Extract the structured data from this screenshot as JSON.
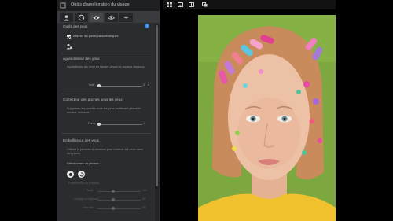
{
  "window": {
    "title": "Outils d'amélioration du visage"
  },
  "tabs": [
    {
      "icon": "portrait-icon",
      "active": false
    },
    {
      "icon": "face-icon",
      "active": false
    },
    {
      "icon": "eye-icon",
      "active": true
    },
    {
      "icon": "eye-outline-icon",
      "active": false
    },
    {
      "icon": "mouth-icon",
      "active": false
    }
  ],
  "eyes_tools": {
    "header": "Outils des yeux",
    "show_points_label": "Afficher les points caractéristiques",
    "show_points_checked": true
  },
  "eye_enlarger": {
    "header": "Agrandisseur des yeux",
    "description": "Agrandissez les yeux en faisant glisser le curseur dessous.",
    "size_label": "Taille",
    "size_value": "0"
  },
  "eye_bags": {
    "header": "Correcteur des poches sous les yeux",
    "description": "Supprimer les poches sous les yeux en faisant glisser le curseur dessous.",
    "strength_label": "Force",
    "strength_value": "0"
  },
  "eye_brightener": {
    "header": "Embellisseur des yeux",
    "description": "Utilisez le pinceau ci-dessous pour éclaircir les yeux dans une photo.",
    "brush_prompt": "Sélectionnez un pinceau :",
    "brush_settings_label": "Paramètres du pinceau",
    "brush_size_label": "Taille",
    "brush_size_value": "100",
    "softness_label": "Lissage progressif",
    "softness_value": "50",
    "opacity_label": "Intensité",
    "opacity_value": "50"
  },
  "colors": {
    "panel_bg": "#2b2c2f",
    "accent": "#2d7fd6",
    "photo_bg": "#7ca83f"
  }
}
